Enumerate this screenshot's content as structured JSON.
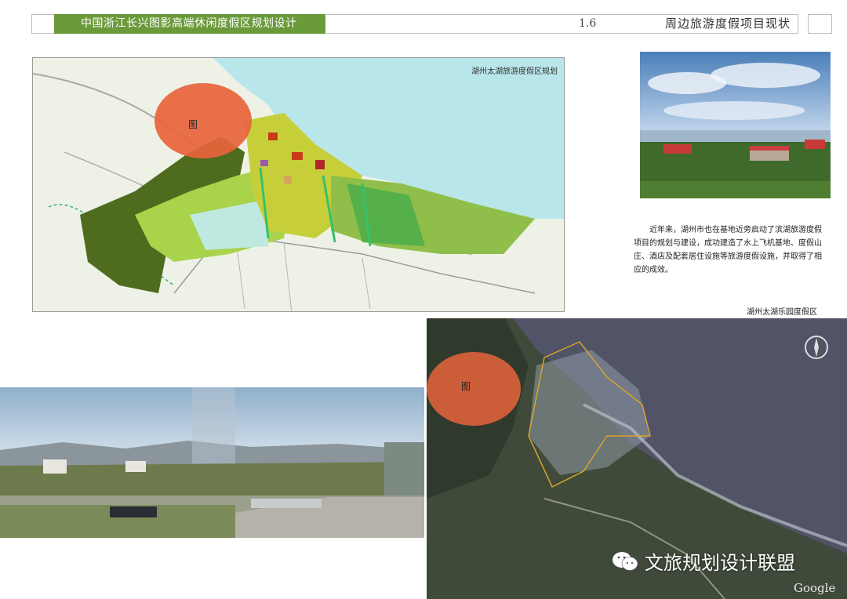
{
  "header": {
    "project_title": "中国浙江长兴图影高端休闲度假区规划设计",
    "section_number": "1.6",
    "section_title": "周边旅游度假项目现状"
  },
  "plan_map": {
    "label": "湖州太湖旅游度假区规划",
    "marker": "图"
  },
  "description": "近年来，湖州市也在基地近旁启动了滨湖旅游度假项目的规划与建设，成功建造了水上飞机基地、度假山庄、酒店及配套居住设施等旅游度假设施，并取得了相应的成效。",
  "satellite": {
    "caption": "湖州太湖乐园度假区",
    "marker": "图",
    "google_logo": "Google"
  },
  "watermark": "文旅规划设计联盟",
  "colors": {
    "header_green": "#6a9a3a",
    "marker_orange": "#e8643c",
    "lake_cyan": "#b9e6ea"
  }
}
